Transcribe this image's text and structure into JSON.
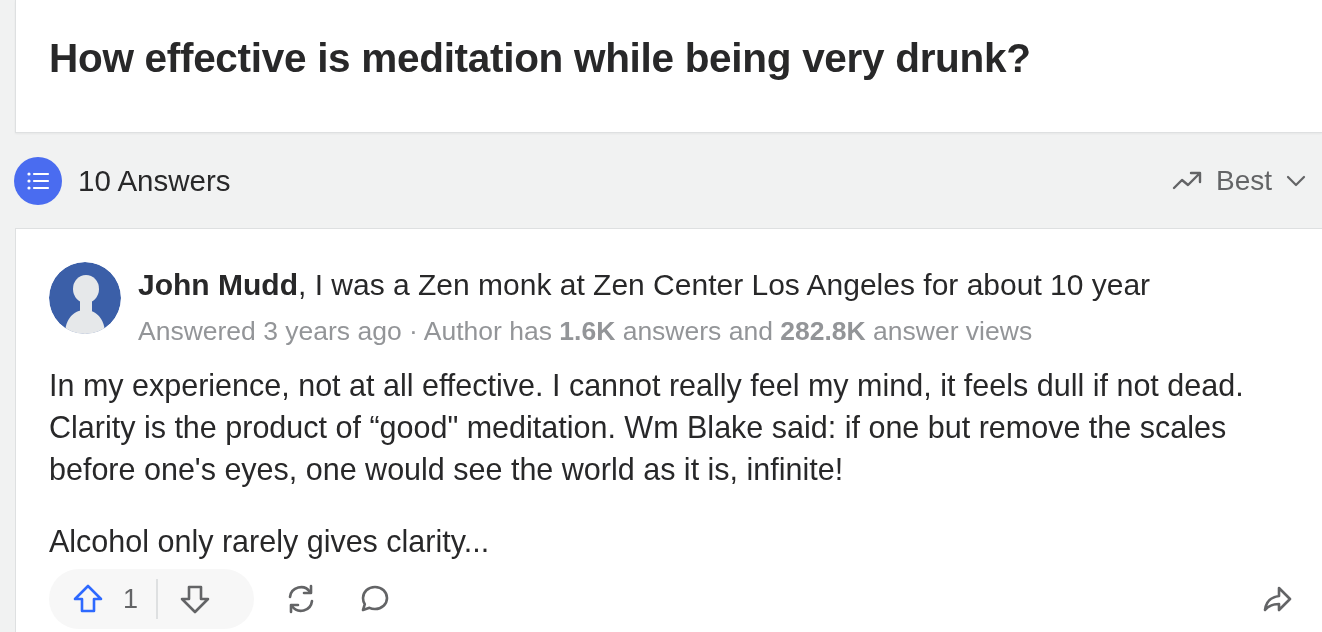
{
  "question": {
    "title": "How effective is meditation while being very drunk?"
  },
  "answers_header": {
    "count_label": "10 Answers",
    "sort": {
      "label": "Best"
    }
  },
  "answer": {
    "author": {
      "name": "John Mudd",
      "credential": ", I was a Zen monk at Zen Center Los Angeles for about 10 year"
    },
    "meta": "Answered 3 years ago · Author has **1.6K** answers and **282.8K** answer views",
    "paragraphs": [
      "In my experience, not at all effective. I cannot really feel my mind, it feels dull if not dead. Clarity is the product of “good\" meditation. Wm Blake said: if one but remove the scales before one's eyes, one would see the world as it is, infinite!",
      "Alcohol only rarely gives clarity..."
    ],
    "actions": {
      "upvotes": "1"
    }
  }
}
